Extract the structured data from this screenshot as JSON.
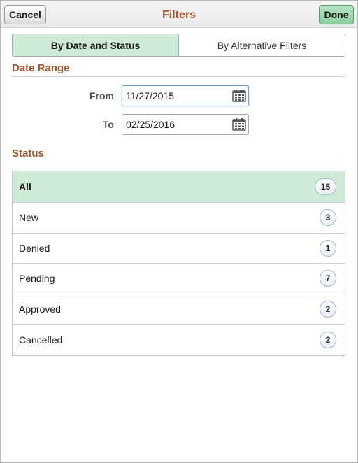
{
  "header": {
    "cancel_label": "Cancel",
    "title": "Filters",
    "done_label": "Done"
  },
  "tabs": [
    {
      "label": "By Date and Status",
      "active": true
    },
    {
      "label": "By Alternative Filters",
      "active": false
    }
  ],
  "date_range": {
    "title": "Date Range",
    "from_label": "From",
    "from_value": "11/27/2015",
    "to_label": "To",
    "to_value": "02/25/2016"
  },
  "status": {
    "title": "Status",
    "items": [
      {
        "label": "All",
        "count": "15",
        "selected": true
      },
      {
        "label": "New",
        "count": "3",
        "selected": false
      },
      {
        "label": "Denied",
        "count": "1",
        "selected": false
      },
      {
        "label": "Pending",
        "count": "7",
        "selected": false
      },
      {
        "label": "Approved",
        "count": "2",
        "selected": false
      },
      {
        "label": "Cancelled",
        "count": "2",
        "selected": false
      }
    ]
  },
  "colors": {
    "accent_title": "#a5552b",
    "selected_bg": "#cdebd6",
    "done_button": "#8dce9e"
  }
}
